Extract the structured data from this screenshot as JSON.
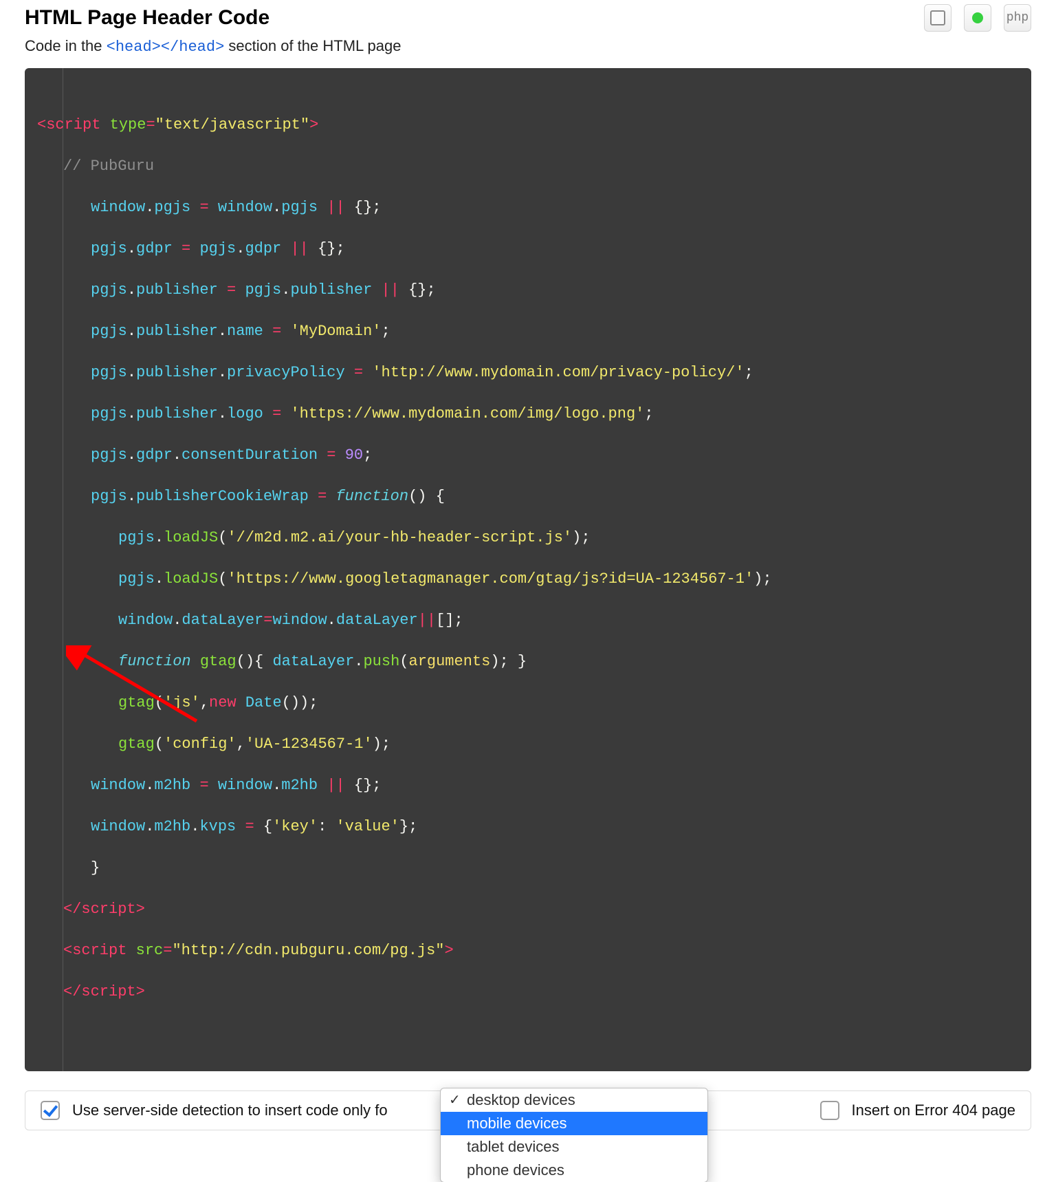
{
  "header": {
    "title": "HTML Page Header Code",
    "subtitle_before": "Code in the ",
    "subtitle_tag": "<head></head>",
    "subtitle_after": " section of the HTML page",
    "php_label": "php"
  },
  "code": {
    "open_tag_name": "script",
    "open_tag_attr": "type",
    "open_tag_val": "\"text/javascript\"",
    "comment": "// PubGuru",
    "l3_a": "window",
    "l3_b": "pgjs",
    "l3_c": "window",
    "l3_d": "pgjs",
    "l4_a": "pgjs",
    "l4_b": "gdpr",
    "l4_c": "pgjs",
    "l4_d": "gdpr",
    "l5_a": "pgjs",
    "l5_b": "publisher",
    "l5_c": "pgjs",
    "l5_d": "publisher",
    "l6_a": "pgjs",
    "l6_b": "publisher",
    "l6_c": "name",
    "l6_str": "'MyDomain'",
    "l7_a": "pgjs",
    "l7_b": "publisher",
    "l7_c": "privacyPolicy",
    "l7_str": "'http://www.mydomain.com/privacy-policy/'",
    "l8_a": "pgjs",
    "l8_b": "publisher",
    "l8_c": "logo",
    "l8_str": "'https://www.mydomain.com/img/logo.png'",
    "l9_a": "pgjs",
    "l9_b": "gdpr",
    "l9_c": "consentDuration",
    "l9_num": "90",
    "l10_a": "pgjs",
    "l10_b": "publisherCookieWrap",
    "l10_fn": "function",
    "l11_a": "pgjs",
    "l11_b": "loadJS",
    "l11_str": "'//m2d.m2.ai/your-hb-header-script.js'",
    "l12_a": "pgjs",
    "l12_b": "loadJS",
    "l12_str": "'https://www.googletagmanager.com/gtag/js?id=UA-1234567-1'",
    "l13_a": "window",
    "l13_b": "dataLayer",
    "l13_c": "window",
    "l13_d": "dataLayer",
    "l14_kw": "function",
    "l14_fn": "gtag",
    "l14_obj": "dataLayer",
    "l14_m": "push",
    "l14_arg": "arguments",
    "l15_fn": "gtag",
    "l15_s1": "'js'",
    "l15_kw": "new",
    "l15_cls": "Date",
    "l16_fn": "gtag",
    "l16_s1": "'config'",
    "l16_s2": "'UA-1234567-1'",
    "l17_a": "window",
    "l17_b": "m2hb",
    "l17_c": "window",
    "l17_d": "m2hb",
    "l18_a": "window",
    "l18_b": "m2hb",
    "l18_c": "kvps",
    "l18_k": "'key'",
    "l18_v": "'value'",
    "close_tag": "script",
    "second_open_tag": "script",
    "second_attr": "src",
    "second_val": "\"http://cdn.pubguru.com/pg.js\"",
    "second_close": "script"
  },
  "options": {
    "server_side_label": "Use server-side detection to insert code only fo",
    "error404_label": "Insert on Error 404 page"
  },
  "dropdown": {
    "items": [
      {
        "label": "desktop devices",
        "checked": true,
        "selected": false
      },
      {
        "label": "mobile devices",
        "checked": false,
        "selected": true
      },
      {
        "label": "tablet devices",
        "checked": false,
        "selected": false
      },
      {
        "label": "phone devices",
        "checked": false,
        "selected": false
      }
    ]
  }
}
